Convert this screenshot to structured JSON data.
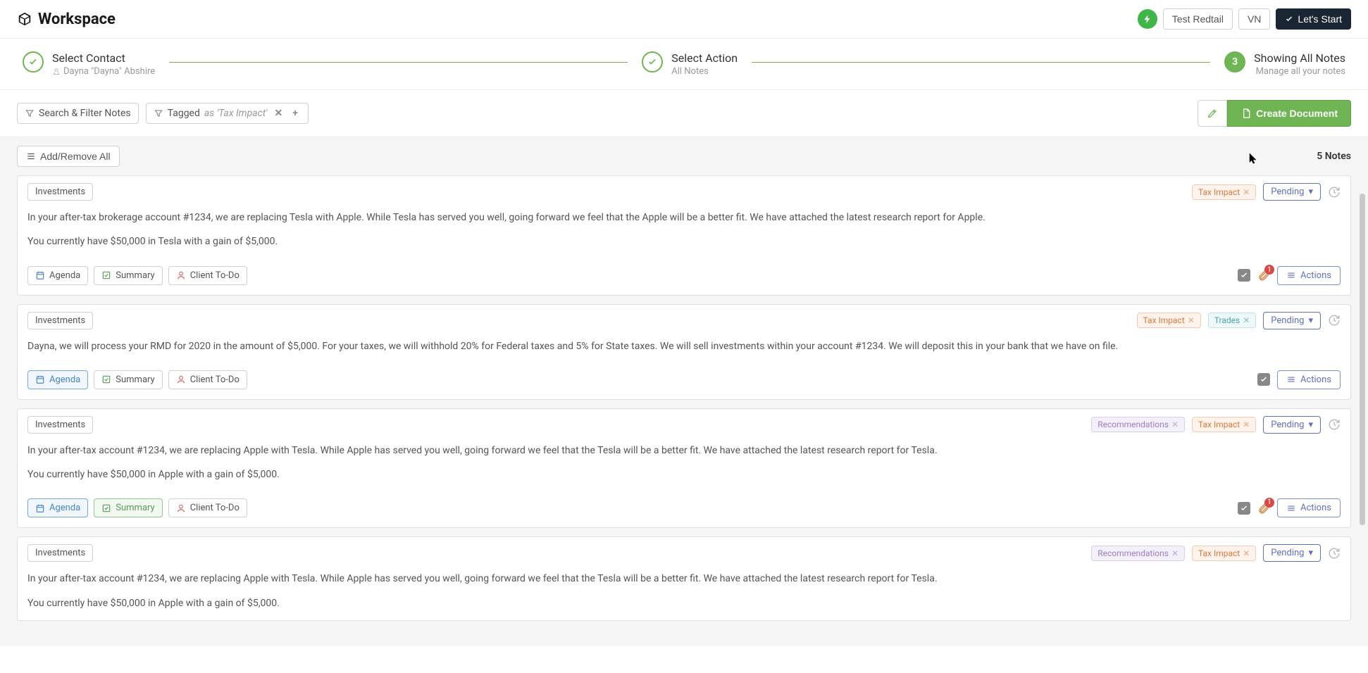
{
  "header": {
    "logo": "Workspace",
    "test_label": "Test Redtail",
    "user_initials": "VN",
    "cta": "Let's Start"
  },
  "steps": {
    "s1_title": "Select Contact",
    "s1_sub": "Dayna \"Dayna\" Abshire",
    "s2_title": "Select Action",
    "s2_sub": "All Notes",
    "s3_num": "3",
    "s3_title": "Showing All Notes",
    "s3_sub": "Manage all your notes"
  },
  "toolbar": {
    "search": "Search & Filter Notes",
    "tag_label": "Tagged",
    "tag_value": "as 'Tax Impact'",
    "create": "Create Document"
  },
  "subbar": {
    "add_remove": "Add/Remove All",
    "count": "5 Notes"
  },
  "common": {
    "pending": "Pending",
    "actions": "Actions",
    "agenda": "Agenda",
    "summary": "Summary",
    "client_todo": "Client To-Do",
    "attach_count": "1"
  },
  "tags": {
    "tax_impact": "Tax Impact",
    "trades": "Trades",
    "recommendations": "Recommendations"
  },
  "notes": [
    {
      "category": "Investments",
      "body1": "In your after-tax brokerage account #1234, we are replacing Tesla with Apple. While Tesla has served you well, going forward we feel that the Apple will be a better fit. We have attached the latest research report for Apple.",
      "body2": "You currently have $50,000 in Tesla with a gain of $5,000."
    },
    {
      "category": "Investments",
      "body1": "Dayna, we will process your RMD for 2020 in the amount of $5,000. For your taxes, we will withhold 20% for Federal taxes and 5% for State taxes. We will sell investments within your account #1234. We will deposit this in your bank that we have on file."
    },
    {
      "category": "Investments",
      "body1": "In your after-tax account #1234, we are replacing Apple with Tesla. While Apple has served you well, going forward we feel that the Tesla will be a better fit. We have attached the latest research report for Tesla.",
      "body2": "You currently have $50,000 in Apple with a gain of $5,000."
    },
    {
      "category": "Investments",
      "body1": "In your after-tax account #1234, we are replacing Apple with Tesla. While Apple has served you well, going forward we feel that the Tesla will be a better fit. We have attached the latest research report for Tesla.",
      "body2": "You currently have $50,000 in Apple with a gain of $5,000."
    }
  ]
}
